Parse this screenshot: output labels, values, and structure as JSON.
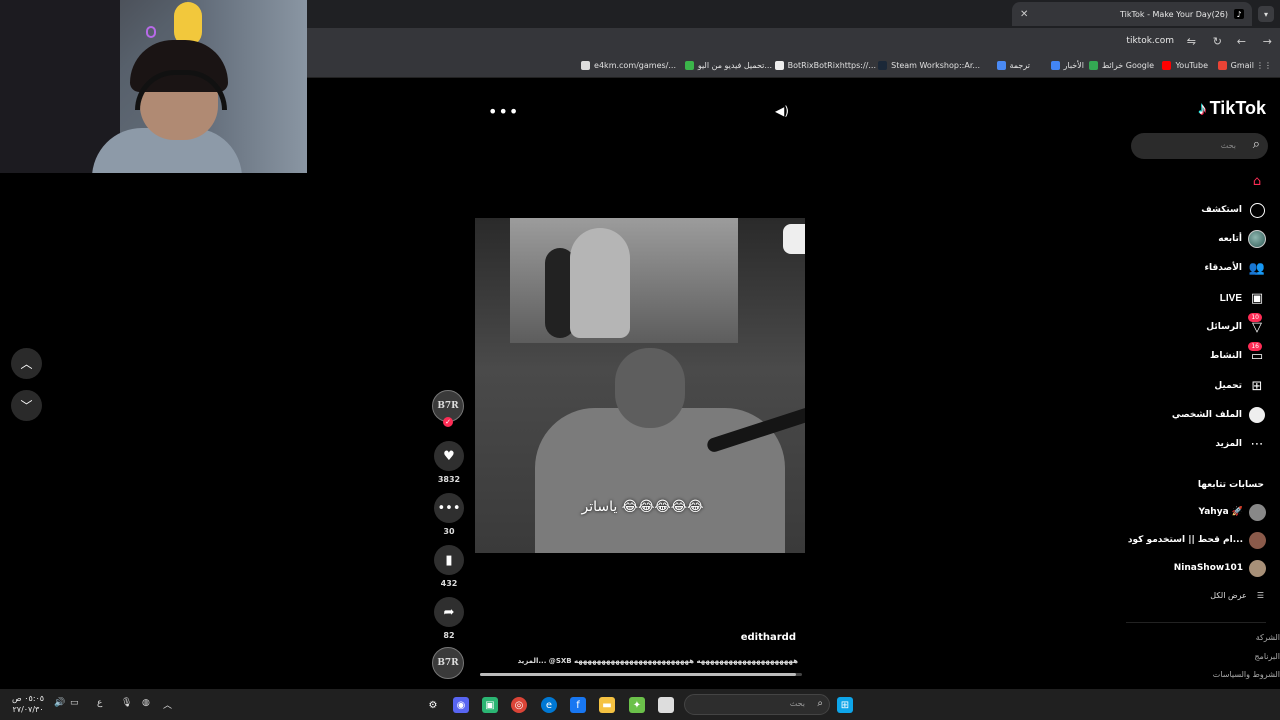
{
  "browser": {
    "tab_title": "(26)TikTok - Make Your Day",
    "url": "tiktok.com",
    "bookmarks": [
      "Gmail",
      "YouTube",
      "خرائط Google",
      "الأخبار",
      "ترجمة",
      "Steam Workshop::Ar...",
      "BotRixBotRixhttps://...",
      "تحميل فيديو من اليو...",
      "e4km.com/games/..."
    ]
  },
  "tiktok": {
    "logo": "TikTok",
    "search_placeholder": "بحث",
    "nav": [
      {
        "label": "",
        "icon": "home-icon",
        "active": true
      },
      {
        "label": "استكشف",
        "icon": "compass-icon"
      },
      {
        "label": "أتابعه",
        "icon": "avatar-icon"
      },
      {
        "label": "الأصدقاء",
        "icon": "friends-icon"
      },
      {
        "label": "LIVE",
        "icon": "live-icon"
      },
      {
        "label": "الرسائل",
        "icon": "messages-icon",
        "badge": "10"
      },
      {
        "label": "النشاط",
        "icon": "activity-icon",
        "badge": "16"
      },
      {
        "label": "تحميل",
        "icon": "upload-icon"
      },
      {
        "label": "الملف الشخصي",
        "icon": "profile-icon"
      },
      {
        "label": "المزيد",
        "icon": "more-icon"
      }
    ],
    "following_title": "حسابات تتابعها",
    "following": [
      {
        "name": "Yahya 🚀"
      },
      {
        "name": "ام قحط || استخدمو كود..."
      },
      {
        "name": "NinaShow101"
      }
    ],
    "see_all": "عرض الكل",
    "footer": [
      "الشركة",
      "البرنامج",
      "الشروط والسياسات"
    ]
  },
  "video": {
    "caption": "ياساتر 😂😂😂😂😂",
    "creator_badge": "B7R",
    "username": "edithardd",
    "description": "هههههههههههههههههههههه هههههههههههههههههههههههههه SXB@ ...المزيد",
    "likes": "3832",
    "comments": "30",
    "saves": "432",
    "shares": "82",
    "progress": 0.98
  },
  "taskbar": {
    "search_placeholder": "بحث",
    "time": "٠٥:٠٥ ص",
    "date": "٢٧/٠٧/٣٠",
    "lang": "ع"
  }
}
